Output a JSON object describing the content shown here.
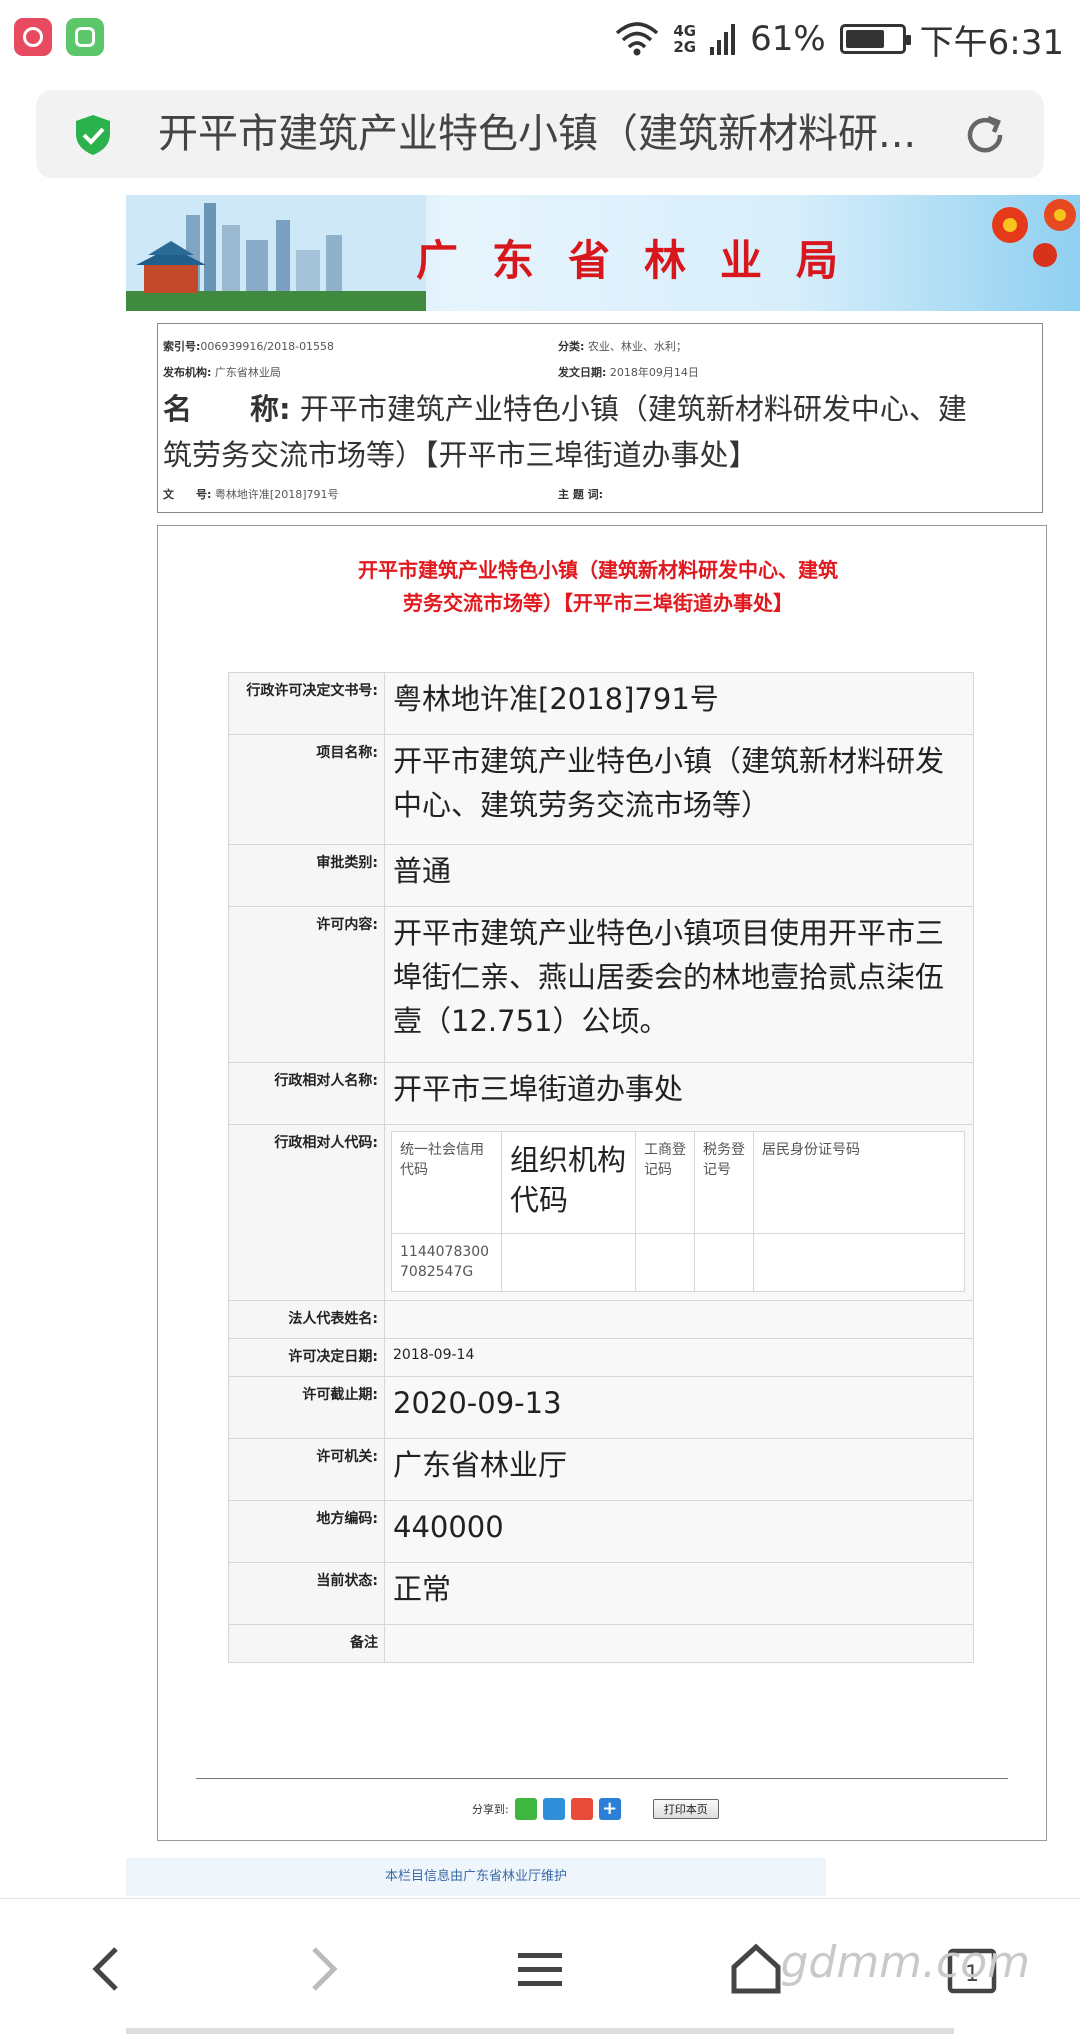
{
  "status": {
    "battery": "61%",
    "time": "下午6:31",
    "network_top": "4G",
    "network_bottom": "2G"
  },
  "address_bar": {
    "title": "开平市建筑产业特色小镇（建筑新材料研..."
  },
  "banner": {
    "title": "广东省林业局"
  },
  "meta": {
    "index_label": "索引号:",
    "index_value": "006939916/2018-01558",
    "category_label": "分类:",
    "category_value": "农业、林业、水利；",
    "publisher_label": "发布机构:",
    "publisher_value": "广东省林业局",
    "date_label": "发文日期:",
    "date_value": "2018年09月14日",
    "name_label": "名　　称:",
    "name_value": "开平市建筑产业特色小镇（建筑新材料研发中心、建筑劳务交流市场等）【开平市三埠街道办事处】",
    "docno_label": "文　　号:",
    "docno_value": "粤林地许准[2018]791号",
    "keywords_label": "主 题 词:",
    "keywords_value": ""
  },
  "content": {
    "title": "开平市建筑产业特色小镇（建筑新材料研发中心、建筑劳务交流市场等）【开平市三埠街道办事处】",
    "rows": {
      "decision_no": {
        "label": "行政许可决定文书号:",
        "value": "粤林地许准[2018]791号"
      },
      "project_name": {
        "label": "项目名称:",
        "value": "开平市建筑产业特色小镇（建筑新材料研发中心、建筑劳务交流市场等）"
      },
      "approval_type": {
        "label": "审批类别:",
        "value": "普通"
      },
      "permit_content": {
        "label": "许可内容:",
        "value": "开平市建筑产业特色小镇项目使用开平市三埠街仁亲、燕山居委会的林地壹拾贰点柒伍壹（12.751）公顷。"
      },
      "party_name": {
        "label": "行政相对人名称:",
        "value": "开平市三埠街道办事处"
      },
      "party_code": {
        "label": "行政相对人代码:",
        "headers": [
          "统一社会信用代码",
          "组织机构代码",
          "工商登记码",
          "税务登记号",
          "居民身份证号码"
        ],
        "values": [
          "11440783007082547G",
          "",
          "",
          "",
          ""
        ]
      },
      "legal_rep": {
        "label": "法人代表姓名:",
        "value": ""
      },
      "decision_date": {
        "label": "许可决定日期:",
        "value": "2018-09-14"
      },
      "expiry_date": {
        "label": "许可截止期:",
        "value": "2020-09-13"
      },
      "authority": {
        "label": "许可机关:",
        "value": "广东省林业厅"
      },
      "region_code": {
        "label": "地方编码:",
        "value": "440000"
      },
      "status": {
        "label": "当前状态:",
        "value": "正常"
      },
      "remarks": {
        "label": "备注",
        "value": ""
      }
    },
    "share_label": "分享到:",
    "print_label": "打印本页"
  },
  "footer": {
    "maintain_text": "本栏目信息由广东省林业厅维护"
  },
  "bottom_nav": {
    "tabs_count": "1",
    "watermark": "gdmm.com"
  }
}
